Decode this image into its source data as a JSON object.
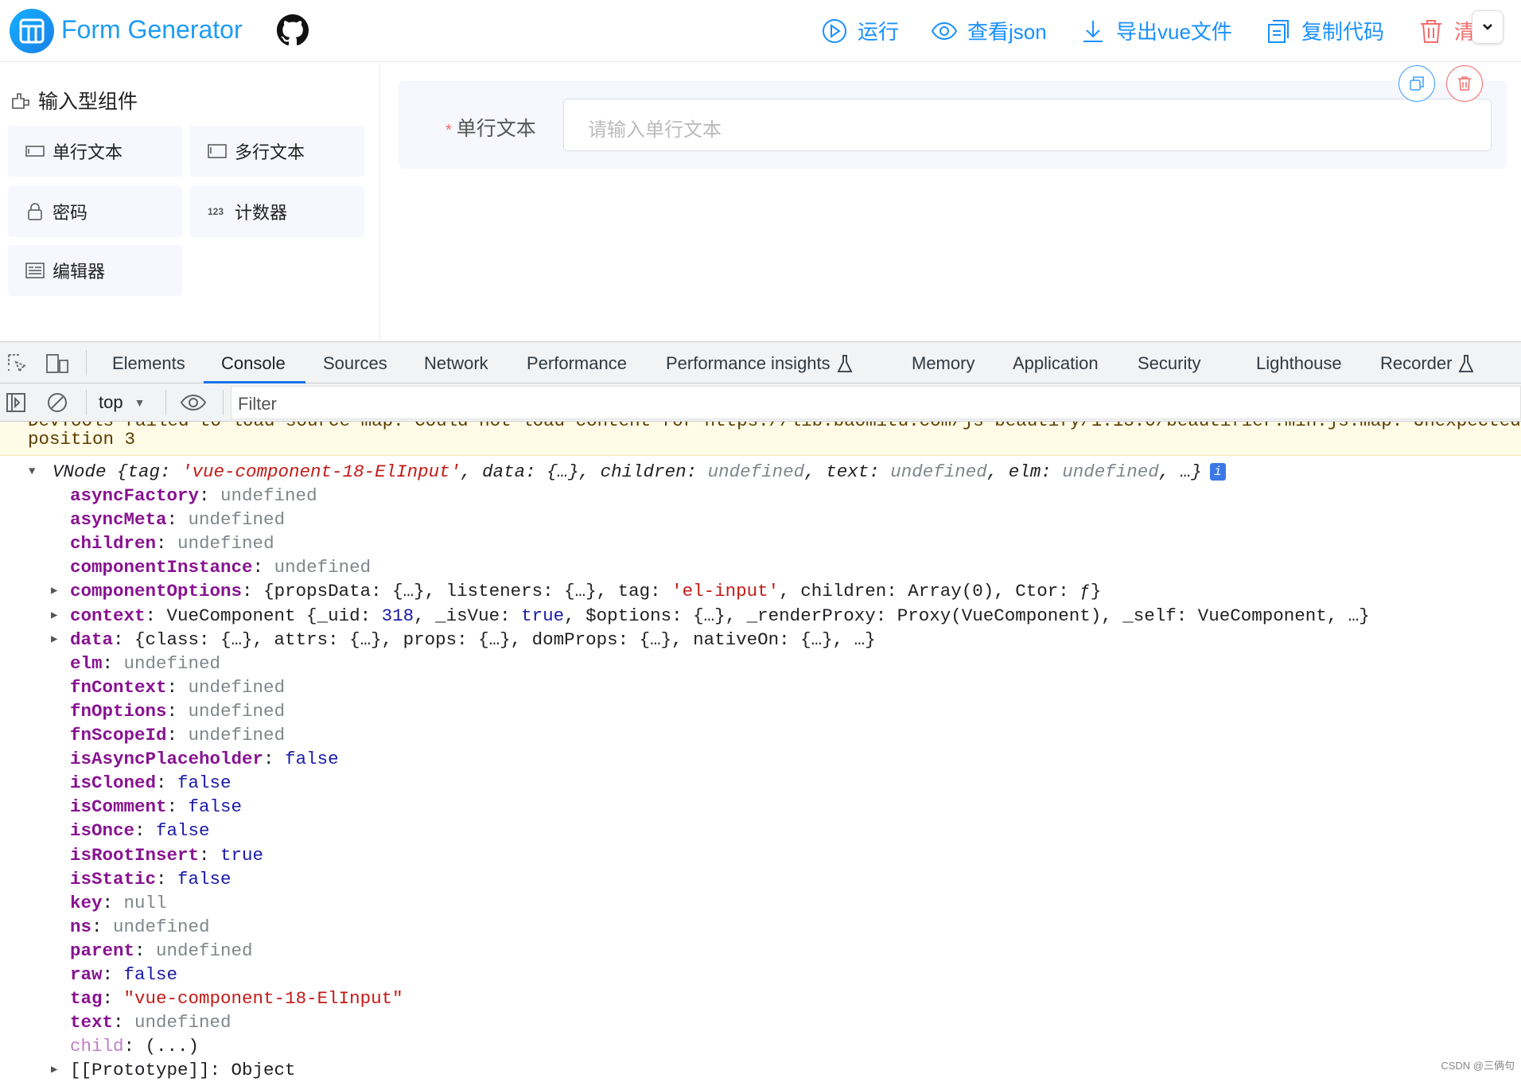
{
  "header": {
    "title": "Form Generator",
    "actions": [
      {
        "label": "运行",
        "icon": "play-circle-icon"
      },
      {
        "label": "查看json",
        "icon": "eye-icon"
      },
      {
        "label": "导出vue文件",
        "icon": "download-icon"
      },
      {
        "label": "复制代码",
        "icon": "copy-icon"
      },
      {
        "label": "清",
        "icon": "trash-icon"
      }
    ]
  },
  "sidebar": {
    "section_title": "输入型组件",
    "components": [
      {
        "label": "单行文本",
        "icon": "input-icon"
      },
      {
        "label": "多行文本",
        "icon": "textarea-icon"
      },
      {
        "label": "密码",
        "icon": "lock-icon"
      },
      {
        "label": "计数器",
        "icon": "number-123-icon"
      },
      {
        "label": "编辑器",
        "icon": "editor-icon"
      }
    ]
  },
  "canvas": {
    "field_label": "单行文本",
    "required_mark": "*",
    "field_placeholder": "请输入单行文本"
  },
  "devtools": {
    "tabs": [
      "Elements",
      "Console",
      "Sources",
      "Network",
      "Performance",
      "Performance insights",
      "Memory",
      "Application",
      "Security",
      "Lighthouse",
      "Recorder"
    ],
    "active_tab": "Console",
    "context": "top",
    "filter_placeholder": "Filter",
    "warning": {
      "line1": "DevTools failed to load source map: Could not load content for https://lib.baomitu.com/js-beautify/1.13.0/beautifier.min.js.map: Unexpected",
      "line2": "position 3"
    },
    "root": {
      "segments": [
        [
          "VNode ",
          "plain"
        ],
        [
          "{tag: ",
          "plain"
        ],
        [
          "'vue-component-18-ElInput'",
          "str"
        ],
        [
          ", data: {…}, children: ",
          "plain"
        ],
        [
          "undefined",
          "undef"
        ],
        [
          ", text: ",
          "plain"
        ],
        [
          "undefined",
          "undef"
        ],
        [
          ", elm: ",
          "plain"
        ],
        [
          "undefined",
          "undef"
        ],
        [
          ", …}",
          "plain"
        ]
      ],
      "info_badge": "i"
    },
    "properties": [
      {
        "key": "asyncFactory",
        "value": [
          [
            "undefined",
            "undef"
          ]
        ]
      },
      {
        "key": "asyncMeta",
        "value": [
          [
            "undefined",
            "undef"
          ]
        ]
      },
      {
        "key": "children",
        "value": [
          [
            "undefined",
            "undef"
          ]
        ]
      },
      {
        "key": "componentInstance",
        "value": [
          [
            "undefined",
            "undef"
          ]
        ]
      },
      {
        "key": "componentOptions",
        "expandable": true,
        "value": [
          [
            "{propsData: {…}, listeners: {…}, tag: ",
            "plain"
          ],
          [
            "'el-input'",
            "str"
          ],
          [
            ", children: Array(0), Ctor: ƒ}",
            "plain"
          ]
        ]
      },
      {
        "key": "context",
        "expandable": true,
        "value": [
          [
            "VueComponent {_uid: ",
            "plain"
          ],
          [
            "318",
            "num"
          ],
          [
            ", _isVue: ",
            "plain"
          ],
          [
            "true",
            "num"
          ],
          [
            ", $options: {…}, _renderProxy: Proxy(VueComponent), _self: VueComponent, …}",
            "plain"
          ]
        ]
      },
      {
        "key": "data",
        "expandable": true,
        "value": [
          [
            "{class: {…}, attrs: {…}, props: {…}, domProps: {…}, nativeOn: {…}, …}",
            "plain"
          ]
        ]
      },
      {
        "key": "elm",
        "value": [
          [
            "undefined",
            "undef"
          ]
        ]
      },
      {
        "key": "fnContext",
        "value": [
          [
            "undefined",
            "undef"
          ]
        ]
      },
      {
        "key": "fnOptions",
        "value": [
          [
            "undefined",
            "undef"
          ]
        ]
      },
      {
        "key": "fnScopeId",
        "value": [
          [
            "undefined",
            "undef"
          ]
        ]
      },
      {
        "key": "isAsyncPlaceholder",
        "value": [
          [
            "false",
            "num"
          ]
        ]
      },
      {
        "key": "isCloned",
        "value": [
          [
            "false",
            "num"
          ]
        ]
      },
      {
        "key": "isComment",
        "value": [
          [
            "false",
            "num"
          ]
        ]
      },
      {
        "key": "isOnce",
        "value": [
          [
            "false",
            "num"
          ]
        ]
      },
      {
        "key": "isRootInsert",
        "value": [
          [
            "true",
            "num"
          ]
        ]
      },
      {
        "key": "isStatic",
        "value": [
          [
            "false",
            "num"
          ]
        ]
      },
      {
        "key": "key",
        "value": [
          [
            "null",
            "undef"
          ]
        ]
      },
      {
        "key": "ns",
        "value": [
          [
            "undefined",
            "undef"
          ]
        ]
      },
      {
        "key": "parent",
        "value": [
          [
            "undefined",
            "undef"
          ]
        ]
      },
      {
        "key": "raw",
        "value": [
          [
            "false",
            "num"
          ]
        ]
      },
      {
        "key": "tag",
        "value": [
          [
            "\"vue-component-18-ElInput\"",
            "str"
          ]
        ]
      },
      {
        "key": "text",
        "value": [
          [
            "undefined",
            "undef"
          ]
        ]
      },
      {
        "key": "child",
        "dim": true,
        "value": [
          [
            "(...)",
            "plain"
          ]
        ]
      },
      {
        "key": "[[Prototype]]",
        "expandable": true,
        "dim": true,
        "plainkey": true,
        "value": [
          [
            "Object",
            "plain"
          ]
        ]
      }
    ]
  },
  "watermark": "CSDN @三俩句"
}
